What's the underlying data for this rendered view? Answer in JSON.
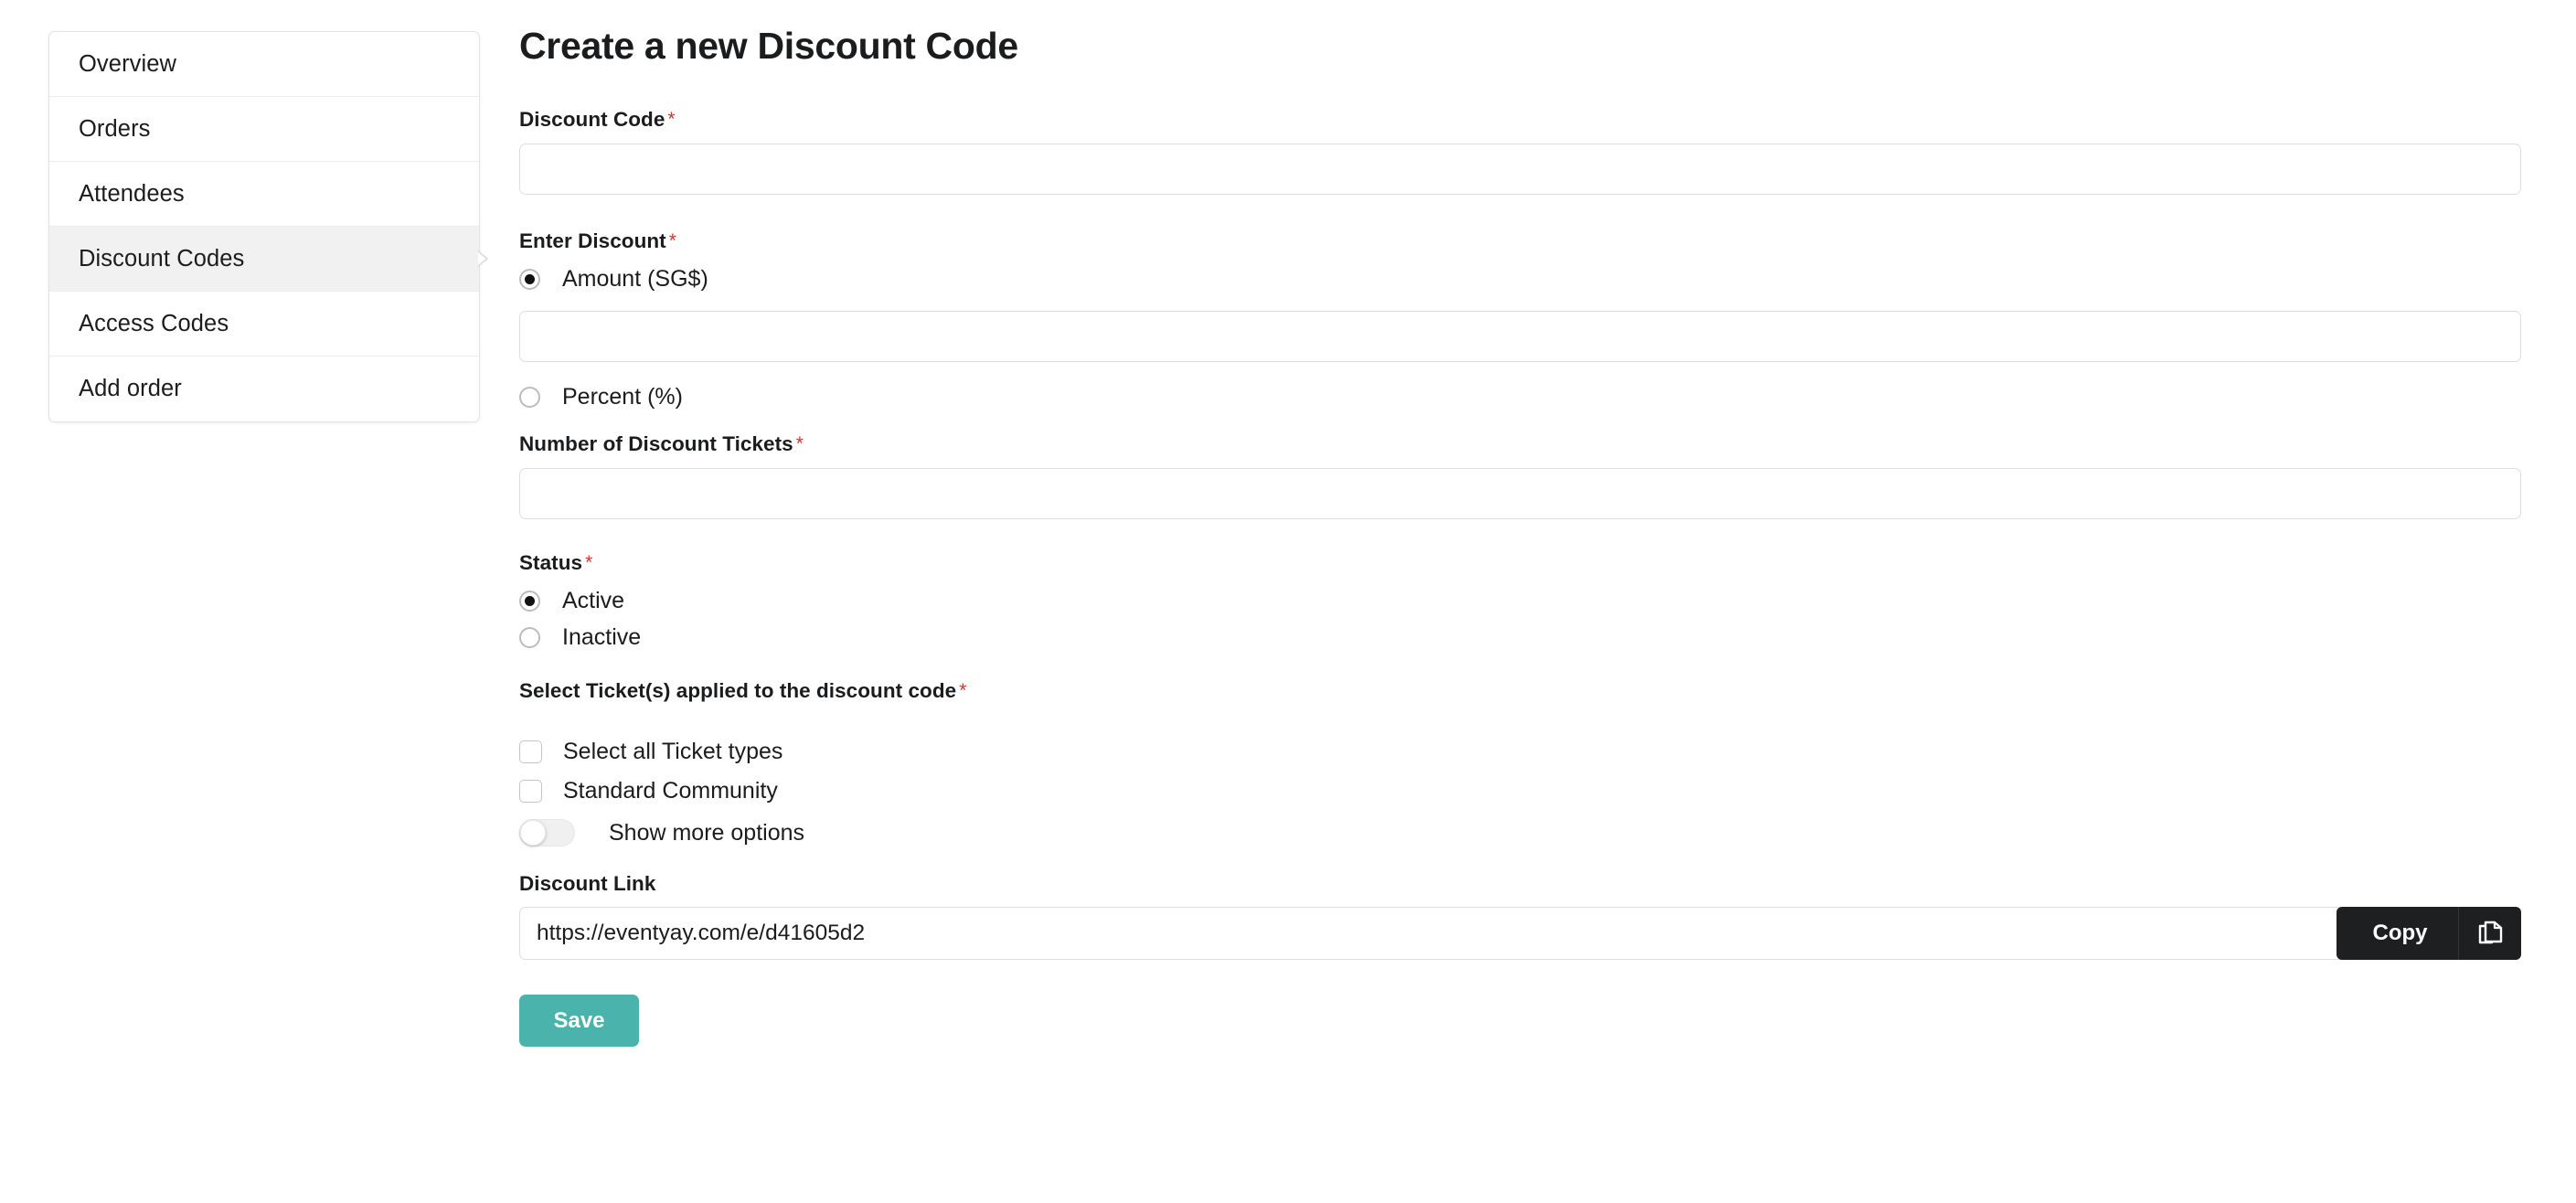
{
  "sidebar": {
    "items": [
      {
        "label": "Overview",
        "active": false
      },
      {
        "label": "Orders",
        "active": false
      },
      {
        "label": "Attendees",
        "active": false
      },
      {
        "label": "Discount Codes",
        "active": true
      },
      {
        "label": "Access Codes",
        "active": false
      },
      {
        "label": "Add order",
        "active": false
      }
    ]
  },
  "main": {
    "title": "Create a new Discount Code",
    "required_marker": "*",
    "fields": {
      "discount_code": {
        "label": "Discount Code",
        "required": true,
        "value": "",
        "placeholder": ""
      },
      "enter_discount": {
        "label": "Enter Discount",
        "required": true,
        "options": [
          {
            "label": "Amount (SG$)",
            "selected": true
          },
          {
            "label": "Percent (%)",
            "selected": false
          }
        ],
        "amount_value": "",
        "amount_placeholder": ""
      },
      "number_of_tickets": {
        "label": "Number of Discount Tickets",
        "required": true,
        "value": "",
        "placeholder": ""
      },
      "status": {
        "label": "Status",
        "required": true,
        "options": [
          {
            "label": "Active",
            "selected": true
          },
          {
            "label": "Inactive",
            "selected": false
          }
        ]
      },
      "select_tickets": {
        "label": "Select Ticket(s) applied to the discount code",
        "required": true,
        "checkboxes": [
          {
            "label": "Select all Ticket types",
            "checked": false
          },
          {
            "label": "Standard Community",
            "checked": false
          }
        ],
        "toggle": {
          "label": "Show more options",
          "on": false
        }
      },
      "discount_link": {
        "label": "Discount Link",
        "required": false,
        "value": "https://eventyay.com/e/d41605d2",
        "copy_label": "Copy"
      }
    },
    "save_label": "Save"
  },
  "colors": {
    "accent_teal": "#4ab3ab",
    "copy_button": "#1d1f20",
    "required_red": "#d0342c",
    "active_item_bg": "#f1f1f1"
  }
}
